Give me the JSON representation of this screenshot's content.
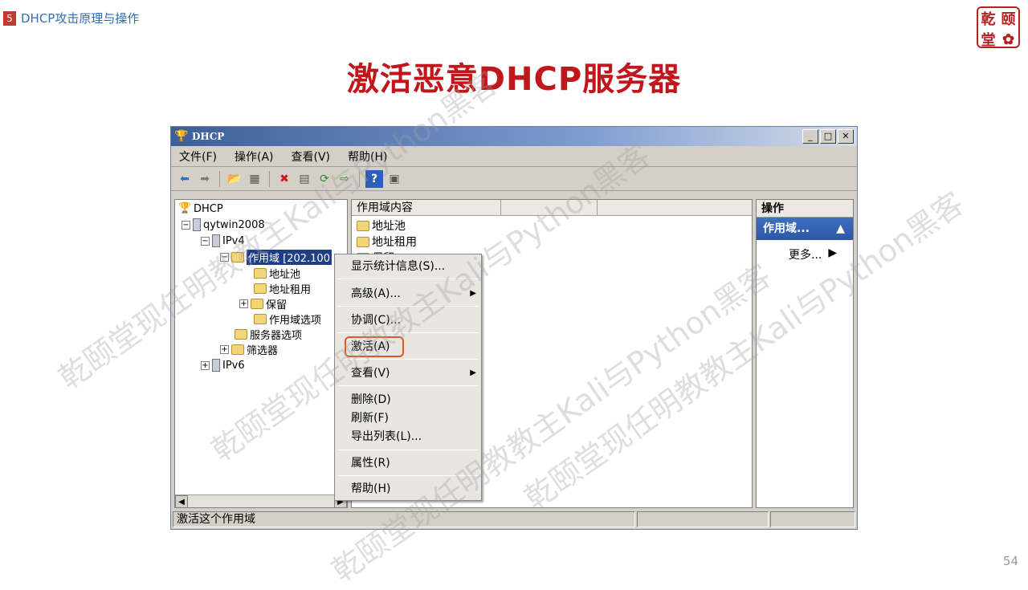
{
  "slide": {
    "section_number": "5",
    "section_title": "DHCP攻击原理与操作",
    "title": "激活恶意DHCP服务器",
    "page_number": "54",
    "logo_chars": [
      "颐",
      "乾",
      "堂",
      "✿"
    ]
  },
  "window": {
    "title": "DHCP",
    "controls": [
      "_",
      "□",
      "✕"
    ]
  },
  "menubar": [
    "文件(F)",
    "操作(A)",
    "查看(V)",
    "帮助(H)"
  ],
  "toolbar_icons": [
    "back-arrow-icon",
    "forward-arrow-icon",
    "up-folder-icon",
    "show-tree-icon",
    "delete-icon",
    "properties-icon",
    "refresh-icon",
    "export-icon",
    "help-icon",
    "console-icon"
  ],
  "tree": {
    "root": "DHCP",
    "server": "qytwin2008",
    "ipv4": "IPv4",
    "scope": "作用域 [202.100",
    "address_pool": "地址池",
    "address_leases": "地址租用",
    "reservations": "保留",
    "scope_options": "作用域选项",
    "server_options": "服务器选项",
    "filters": "筛选器",
    "ipv6": "IPv6"
  },
  "content": {
    "column_header": "作用域内容",
    "items": [
      "地址池",
      "地址租用",
      "保留"
    ]
  },
  "actions": {
    "header": "操作",
    "subheader": "作用域...",
    "more": "更多..."
  },
  "context_menu": {
    "show_stats": "显示统计信息(S)...",
    "advanced": "高级(A)...",
    "reconcile": "协调(C)...",
    "activate": "激活(A)",
    "view": "查看(V)",
    "delete": "删除(D)",
    "refresh": "刷新(F)",
    "export": "导出列表(L)...",
    "properties": "属性(R)",
    "help": "帮助(H)"
  },
  "statusbar": {
    "text": "激活这个作用域"
  },
  "watermark": "乾颐堂现任明教教主Kali与Python黑客",
  "colors": {
    "title_red": "#c0161c",
    "section_blue": "#2f6db5",
    "highlight_orange": "#d9592e",
    "selection_blue": "#1f3e8a"
  }
}
